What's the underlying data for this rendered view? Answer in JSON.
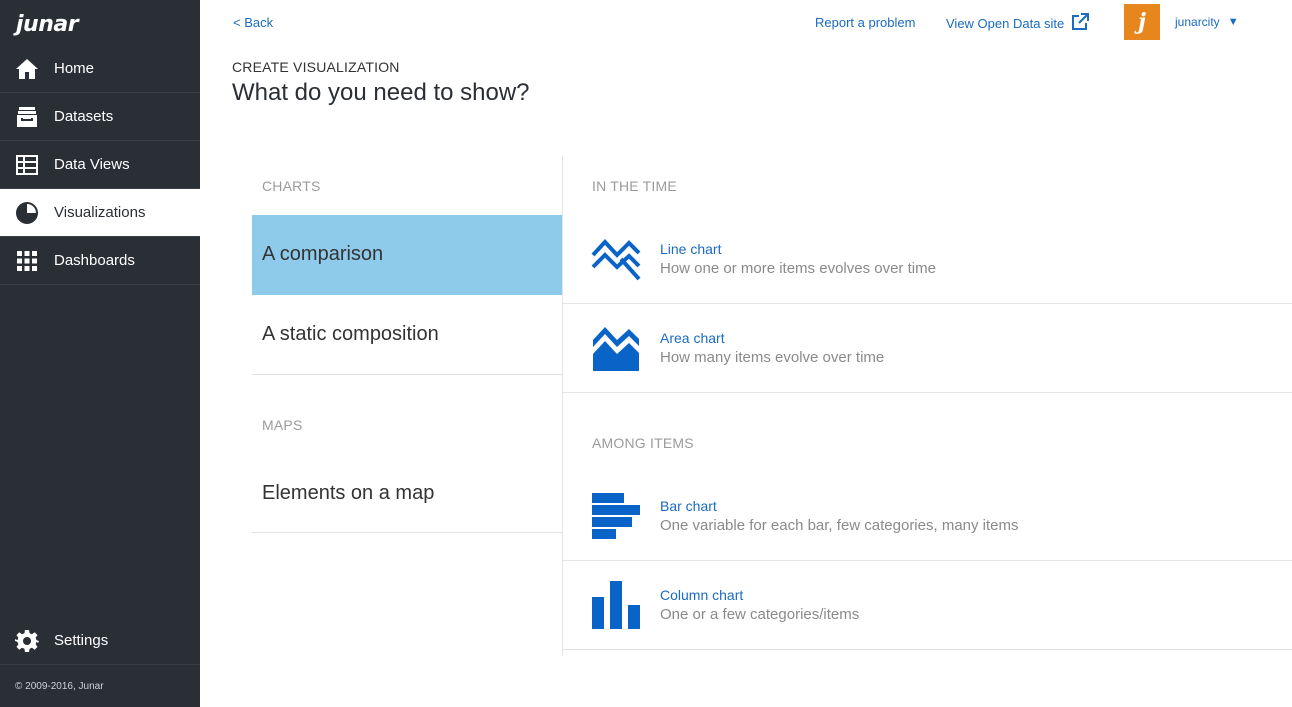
{
  "app": {
    "logo_text": "junar",
    "copyright": "© 2009-2016, Junar"
  },
  "sidebar": {
    "items": [
      {
        "label": "Home",
        "icon": "home-icon"
      },
      {
        "label": "Datasets",
        "icon": "datasets-icon"
      },
      {
        "label": "Data Views",
        "icon": "table-icon"
      },
      {
        "label": "Visualizations",
        "icon": "pie-chart-icon",
        "active": true
      },
      {
        "label": "Dashboards",
        "icon": "grid-icon"
      }
    ],
    "settings_label": "Settings"
  },
  "topbar": {
    "back": "< Back",
    "report": "Report a problem",
    "view_site": "View Open Data site",
    "avatar_letter": "j",
    "username": "junarcity",
    "caret": "▼"
  },
  "page": {
    "subtitle": "CREATE VISUALIZATION",
    "title": "What do you need to show?"
  },
  "categories": {
    "charts_label": "CHARTS",
    "charts": [
      {
        "label": "A comparison",
        "active": true
      },
      {
        "label": "A static composition"
      }
    ],
    "maps_label": "MAPS",
    "maps": [
      {
        "label": "Elements on a map"
      }
    ]
  },
  "options": {
    "in_time_label": "IN THE TIME",
    "in_time": [
      {
        "title": "Line chart",
        "desc": "How one or more items evolves over time",
        "icon": "line-chart-icon"
      },
      {
        "title": "Area chart",
        "desc": "How many items evolve over time",
        "icon": "area-chart-icon"
      }
    ],
    "among_label": "AMONG ITEMS",
    "among": [
      {
        "title": "Bar chart",
        "desc": "One variable for each bar, few categories, many items",
        "icon": "bar-chart-icon"
      },
      {
        "title": "Column chart",
        "desc": "One or a few categories/items",
        "icon": "column-chart-icon"
      }
    ]
  },
  "colors": {
    "sidebar_bg": "#2a2e35",
    "link": "#1a6bc2",
    "active_category": "#8ecbea",
    "icon_blue": "#0a64c8",
    "avatar": "#e8861e"
  }
}
